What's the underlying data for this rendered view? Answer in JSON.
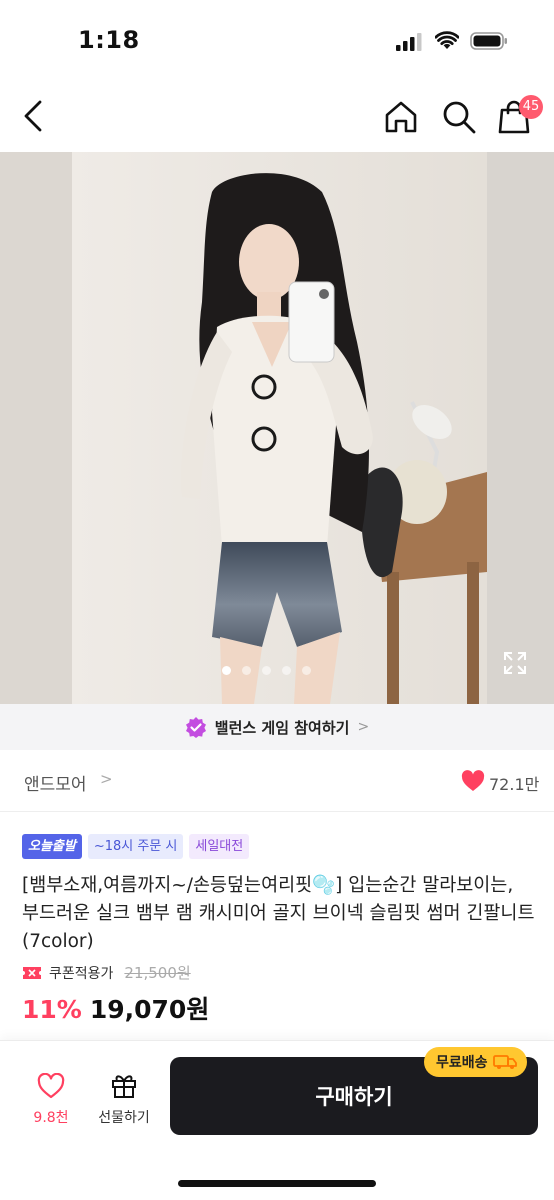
{
  "status_bar": {
    "time": "1:18"
  },
  "nav": {
    "cart_badge": "45"
  },
  "hero": {
    "slide_count": 5,
    "active_slide": 1
  },
  "banner": {
    "text": "밸런스 게임 참여하기",
    "chevron": ">"
  },
  "brand": {
    "name": "앤드모어",
    "chevron": ">",
    "like_count": "72.1만"
  },
  "tags": {
    "today": "오늘출발",
    "time": "~18시 주문 시",
    "sale": "세일대전"
  },
  "product": {
    "title": "[뱀부소재,여름까지~/손등덮는여리핏🫧] 입는순간 말라보이는, 부드러운 실크 뱀부 램 캐시미어 골지 브이넥 슬림핏 썸머 긴팔니트 (7color)",
    "coupon_label": "쿠폰적용가",
    "original_price": "21,500원",
    "discount": "11%",
    "sale_price": "19,070원"
  },
  "bottom": {
    "wish_count": "9.8천",
    "gift_label": "선물하기",
    "buy_label": "구매하기",
    "free_ship": "무료배송"
  },
  "colors": {
    "accent_pink": "#ff4060",
    "cart_badge": "#ff5a6e",
    "today_tag": "#5464e8",
    "free_ship": "#ffc730",
    "buy_button": "#1b1b1f"
  }
}
